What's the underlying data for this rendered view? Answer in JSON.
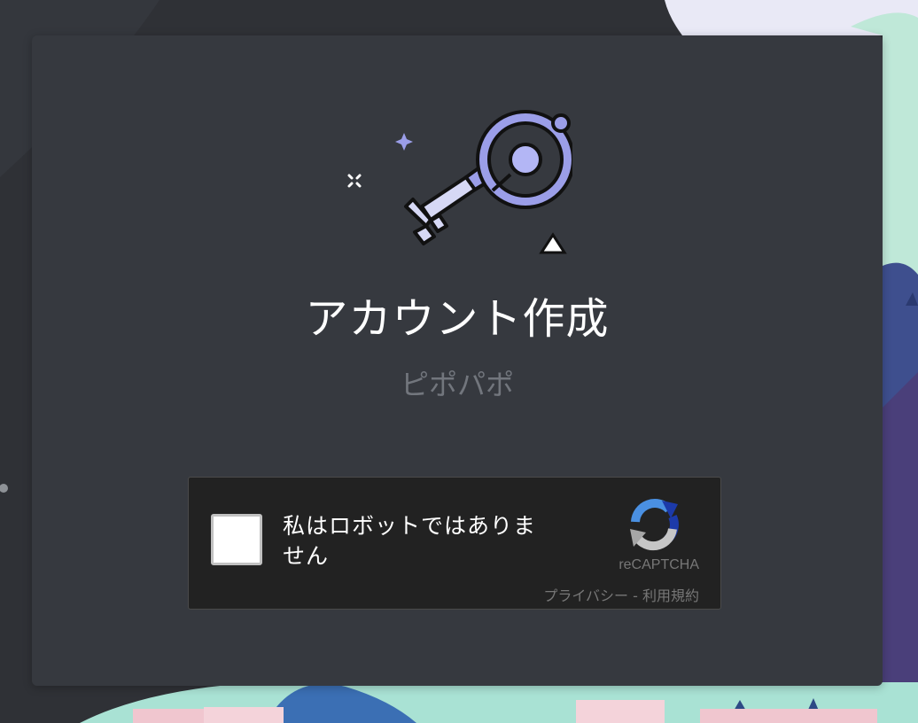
{
  "modal": {
    "title": "アカウント作成",
    "subtitle": "ピポパポ"
  },
  "recaptcha": {
    "label": "私はロボットではありません",
    "brand": "reCAPTCHA",
    "privacy_link": "プライバシー",
    "separator": " - ",
    "terms_link": "利用規約",
    "checked": false
  },
  "icons": {
    "hero": "key-icon",
    "recaptcha_logo": "recaptcha-logo-icon"
  },
  "colors": {
    "accent": "#7289da",
    "key_fill": "#b9bbf5",
    "background": "#2f3136",
    "modal": "#36393f"
  }
}
